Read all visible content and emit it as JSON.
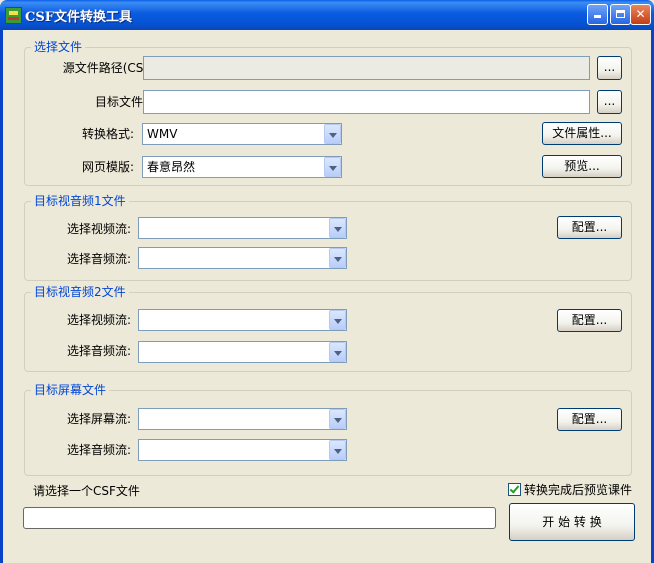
{
  "window": {
    "title": "CSF文件转换工具"
  },
  "source_group": {
    "title": "选择文件",
    "csf_path_label": "源文件路径(CSF):",
    "csf_path_value": "",
    "target_folder_label": "目标文件夹:",
    "target_folder_value": "",
    "browse_label": "...",
    "format_label": "转换格式:",
    "format_value": "WMV",
    "file_props_label": "文件属性...",
    "template_label": "网页模版:",
    "template_value": "春意昂然",
    "preview_label": "预览..."
  },
  "av1_group": {
    "title": "目标视音频1文件",
    "video_label": "选择视频流:",
    "audio_label": "选择音频流:",
    "config_label": "配置..."
  },
  "av2_group": {
    "title": "目标视音频2文件",
    "video_label": "选择视频流:",
    "audio_label": "选择音频流:",
    "config_label": "配置..."
  },
  "screen_group": {
    "title": "目标屏幕文件",
    "screen_label": "选择屏幕流:",
    "audio_label": "选择音频流:",
    "config_label": "配置..."
  },
  "footer": {
    "status_text": "请选择一个CSF文件",
    "preview_after_label": "转换完成后预览课件",
    "preview_after_checked": true,
    "progress": 0,
    "start_label": "开 始 转 换"
  }
}
